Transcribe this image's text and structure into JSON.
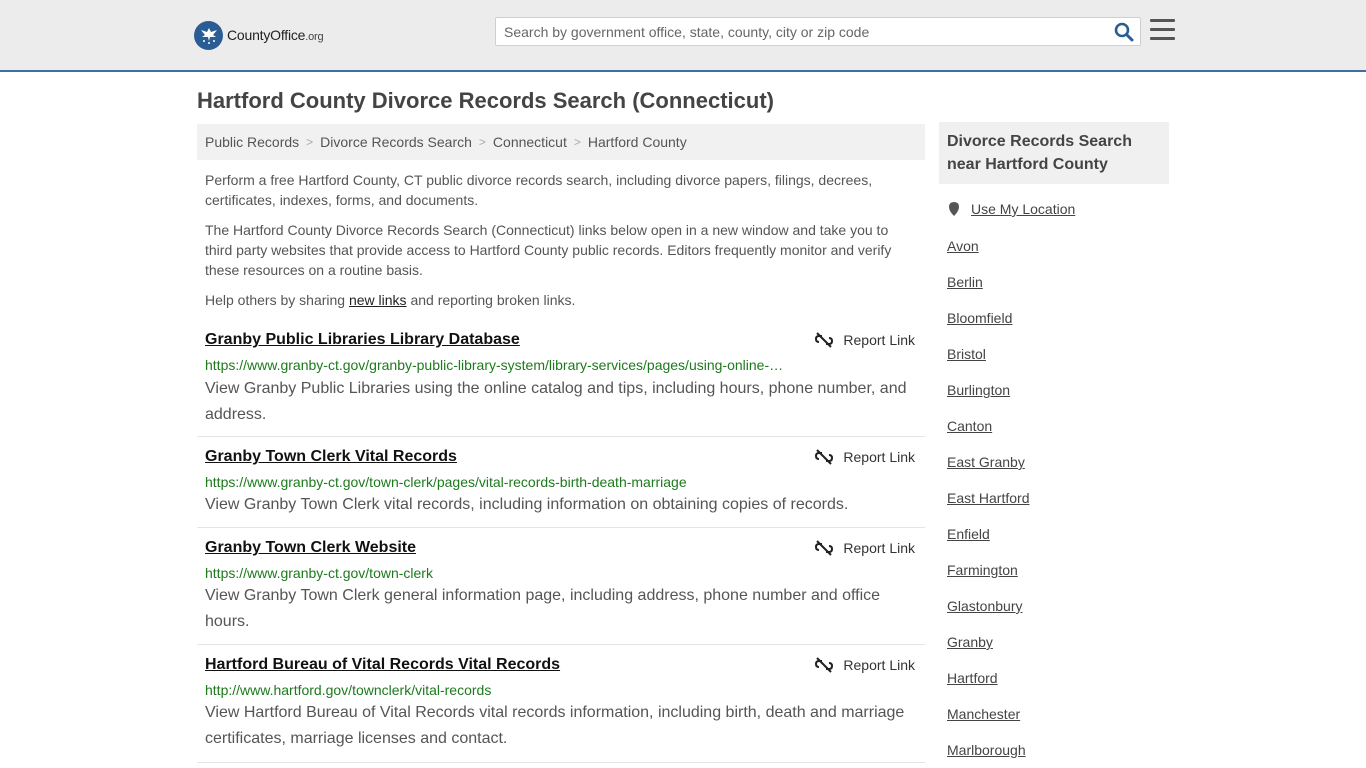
{
  "header": {
    "logo_main": "CountyOffice",
    "logo_suffix": ".org",
    "search_placeholder": "Search by government office, state, county, city or zip code"
  },
  "page": {
    "title": "Hartford County Divorce Records Search (Connecticut)"
  },
  "breadcrumb": [
    "Public Records",
    "Divorce Records Search",
    "Connecticut",
    "Hartford County"
  ],
  "intro": {
    "p1": "Perform a free Hartford County, CT public divorce records search, including divorce papers, filings, decrees, certificates, indexes, forms, and documents.",
    "p2": "The Hartford County Divorce Records Search (Connecticut) links below open in a new window and take you to third party websites that provide access to Hartford County public records. Editors frequently monitor and verify these resources on a routine basis.",
    "p3_before": "Help others by sharing ",
    "p3_link": "new links",
    "p3_after": " and reporting broken links."
  },
  "report_label": "Report Link",
  "results": [
    {
      "title": "Granby Public Libraries Library Database",
      "url": "https://www.granby-ct.gov/granby-public-library-system/library-services/pages/using-online-…",
      "desc": "View Granby Public Libraries using the online catalog and tips, including hours, phone number, and address."
    },
    {
      "title": "Granby Town Clerk Vital Records",
      "url": "https://www.granby-ct.gov/town-clerk/pages/vital-records-birth-death-marriage",
      "desc": "View Granby Town Clerk vital records, including information on obtaining copies of records."
    },
    {
      "title": "Granby Town Clerk Website",
      "url": "https://www.granby-ct.gov/town-clerk",
      "desc": "View Granby Town Clerk general information page, including address, phone number and office hours."
    },
    {
      "title": "Hartford Bureau of Vital Records Vital Records",
      "url": "http://www.hartford.gov/townclerk/vital-records",
      "desc": "View Hartford Bureau of Vital Records vital records information, including birth, death and marriage certificates, marriage licenses and contact."
    }
  ],
  "sidebar": {
    "title": "Divorce Records Search near Hartford County",
    "use_location": "Use My Location",
    "cities": [
      "Avon",
      "Berlin",
      "Bloomfield",
      "Bristol",
      "Burlington",
      "Canton",
      "East Granby",
      "East Hartford",
      "Enfield",
      "Farmington",
      "Glastonbury",
      "Granby",
      "Hartford",
      "Manchester",
      "Marlborough"
    ]
  },
  "colors": {
    "brand_blue": "#2b5d95",
    "header_bg": "#ececec",
    "url_green": "#1d7a1d"
  }
}
